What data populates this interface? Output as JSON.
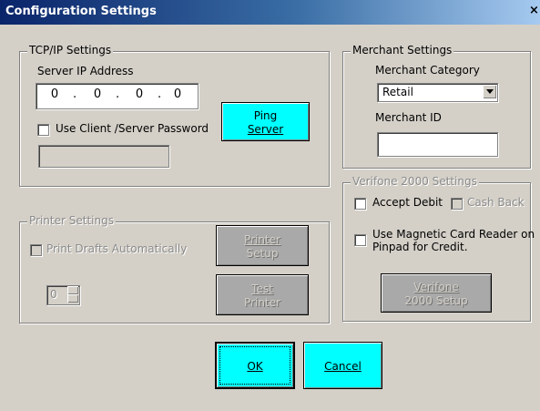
{
  "window": {
    "title": "Configuration Settings",
    "close_label": "×"
  },
  "tcpip": {
    "legend": "TCP/IP Settings",
    "server_ip_label": "Server IP Address",
    "ip_octets": [
      "0",
      "0",
      "0",
      "0"
    ],
    "ip_separator": ".",
    "use_password_label": "Use Client /Server Password",
    "use_password_checked": false,
    "password_value": "",
    "ping_button": {
      "line1": "Ping",
      "line2": "Server"
    }
  },
  "merchant": {
    "legend": "Merchant Settings",
    "category_label": "Merchant Category",
    "category_value": "Retail",
    "merchant_id_label": "Merchant ID",
    "merchant_id_value": ""
  },
  "verifone": {
    "legend": "Verifone 2000 Settings",
    "accept_debit_label": "Accept Debit",
    "accept_debit_checked": false,
    "cash_back_label": "Cash Back",
    "cash_back_checked": false,
    "mag_reader_line1": "Use Magnetic Card Reader on",
    "mag_reader_line2": "Pinpad for Credit.",
    "mag_reader_checked": false,
    "setup_button": {
      "line1": "Verifone",
      "line2": "2000 Setup"
    }
  },
  "printer": {
    "legend": "Printer Settings",
    "print_drafts_label": "Print Drafts Automatically",
    "print_drafts_checked": false,
    "copies_value": "0",
    "printer_setup_button": {
      "line1": "Printer",
      "line2": "Setup"
    },
    "test_printer_button": {
      "line1": "Test",
      "line2": "Printer"
    }
  },
  "dialog_buttons": {
    "ok": "OK",
    "cancel": "Cancel"
  },
  "colors": {
    "accent_button": "#00ffff",
    "title_bar": "#0a246a",
    "dialog_bg": "#d4d0c8"
  }
}
